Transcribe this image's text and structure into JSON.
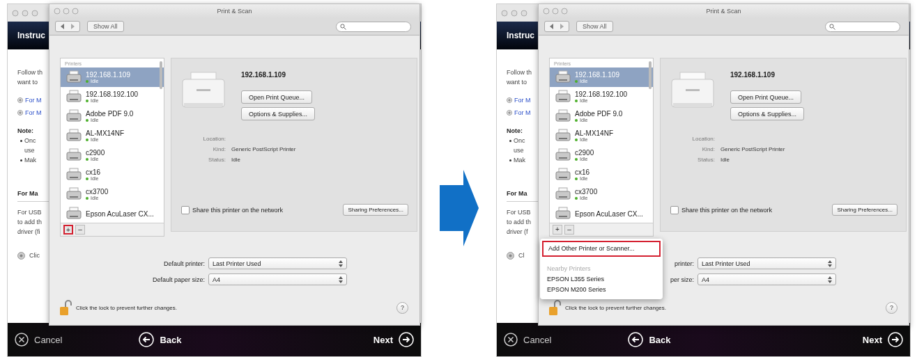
{
  "panels": [
    {
      "installer": {
        "header": "Instruc",
        "intro": [
          "Follow th",
          "want to"
        ],
        "links": [
          "For M",
          "For M"
        ],
        "note_heading": "Note:",
        "notes": [
          {
            "text": "Onc",
            "bullet": true
          },
          {
            "text": "use",
            "bullet": false
          },
          {
            "text": "Mak",
            "bullet": true
          }
        ],
        "section_heading": "For Ma",
        "section_lines": [
          "For USB",
          "to add th",
          "driver (fi"
        ],
        "action": "Clic",
        "cancel": "Cancel",
        "back": "Back",
        "next": "Next"
      },
      "print_scan": {
        "title": "Print & Scan",
        "show_all": "Show All",
        "list_header": "Printers",
        "printers": [
          {
            "name": "192.168.1.109",
            "status": "Idle",
            "selected": true
          },
          {
            "name": "192.168.192.100",
            "status": "Idle",
            "selected": false
          },
          {
            "name": "Adobe PDF 9.0",
            "status": "Idle",
            "selected": false
          },
          {
            "name": "AL-MX14NF",
            "status": "Idle",
            "selected": false
          },
          {
            "name": "c2900",
            "status": "Idle",
            "selected": false
          },
          {
            "name": "cx16",
            "status": "Idle",
            "selected": false
          },
          {
            "name": "cx3700",
            "status": "Idle",
            "selected": false
          },
          {
            "name": "Epson AcuLaser CX...",
            "selected": false
          }
        ],
        "add_button": {
          "label": "+",
          "highlighted": true
        },
        "remove_button": {
          "label": "–"
        },
        "detail": {
          "name": "192.168.1.109",
          "buttons": [
            "Open Print Queue...",
            "Options & Supplies..."
          ],
          "fields": [
            {
              "label": "Location:"
            },
            {
              "label": "Kind:",
              "value": "Generic PostScript Printer"
            },
            {
              "label": "Status:",
              "value": "Idle"
            }
          ],
          "share": {
            "label": "Share this printer on the network",
            "checked": false
          },
          "sharing_button": "Sharing Preferences..."
        },
        "defaults": [
          {
            "label": "Default printer:",
            "value": "Last Printer Used"
          },
          {
            "label": "Default paper size:",
            "value": "A4"
          }
        ],
        "lock_text": "Click the lock to prevent further changes.",
        "help": "?"
      }
    },
    {
      "installer": {
        "header": "Instruc",
        "intro": [
          "Follow th",
          "want to"
        ],
        "links": [
          "For M",
          "For M"
        ],
        "note_heading": "Note:",
        "notes": [
          {
            "text": "Onc",
            "bullet": true
          },
          {
            "text": "use",
            "bullet": false
          },
          {
            "text": "Mak",
            "bullet": true
          }
        ],
        "section_heading": "For Ma",
        "section_lines": [
          "For USB",
          "to add th",
          "driver (f"
        ],
        "action": "Cl",
        "cancel": "Cancel",
        "back": "Back",
        "next": "Next"
      },
      "print_scan": {
        "title": "Print & Scan",
        "show_all": "Show All",
        "list_header": "Printers",
        "printers": [
          {
            "name": "192.168.1.109",
            "status": "Idle",
            "selected": true
          },
          {
            "name": "192.168.192.100",
            "status": "Idle",
            "selected": false
          },
          {
            "name": "Adobe PDF 9.0",
            "status": "Idle",
            "selected": false
          },
          {
            "name": "AL-MX14NF",
            "status": "Idle",
            "selected": false
          },
          {
            "name": "c2900",
            "status": "Idle",
            "selected": false
          },
          {
            "name": "cx16",
            "status": "Idle",
            "selected": false
          },
          {
            "name": "cx3700",
            "status": "Idle",
            "selected": false
          },
          {
            "name": "Epson AcuLaser CX...",
            "selected": false
          }
        ],
        "add_button": {
          "label": "+",
          "highlighted": false
        },
        "remove_button": {
          "label": "–"
        },
        "detail": {
          "name": "192.168.1.109",
          "buttons": [
            "Open Print Queue...",
            "Options & Supplies..."
          ],
          "fields": [
            {
              "label": "Location:"
            },
            {
              "label": "Kind:",
              "value": "Generic PostScript Printer"
            },
            {
              "label": "Status:",
              "value": "Idle"
            }
          ],
          "share": {
            "label": "Share this printer on the network",
            "checked": false
          },
          "sharing_button": "Sharing Preferences..."
        },
        "defaults": [
          {
            "label": "printer:",
            "value": "Last Printer Used"
          },
          {
            "label": "per size:",
            "value": "A4"
          }
        ],
        "lock_text": "Click the lock to prevent further changes.",
        "help": "?"
      },
      "popup_menu": {
        "items": [
          {
            "kind": "action",
            "label": "Add Other Printer or Scanner...",
            "highlighted": true
          },
          {
            "kind": "header",
            "label": "Nearby Printers"
          },
          {
            "kind": "item",
            "label": "EPSON L355 Series"
          },
          {
            "kind": "item",
            "label": "EPSON M200 Series"
          }
        ]
      }
    }
  ]
}
